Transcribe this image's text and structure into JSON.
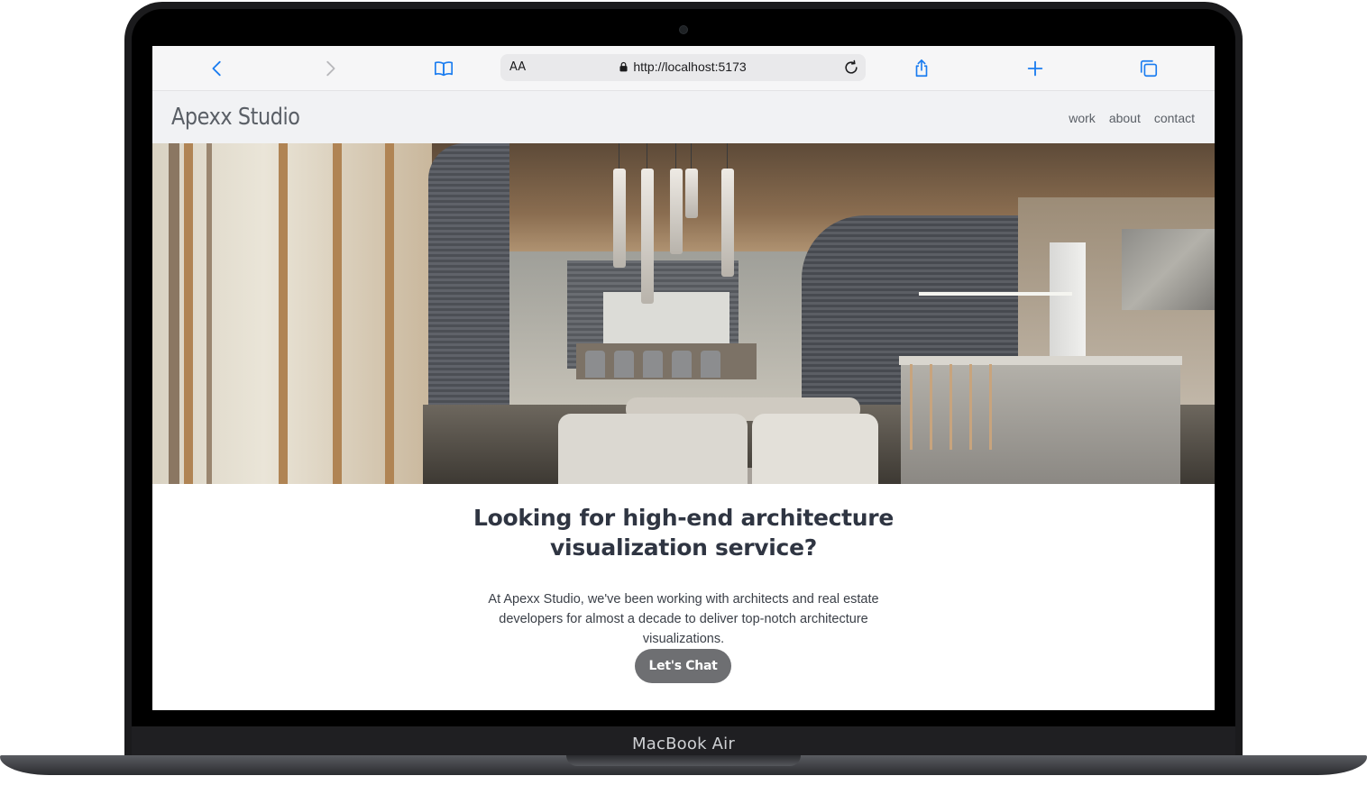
{
  "device": {
    "label": "MacBook Air"
  },
  "browser": {
    "text_size_label": "AA",
    "url": "http://localhost:5173",
    "icons": {
      "back": "chevron-left-icon",
      "forward": "chevron-right-icon",
      "bookmarks": "book-icon",
      "lock": "lock-icon",
      "reload": "reload-icon",
      "share": "share-icon",
      "new_tab": "plus-icon",
      "tabs": "tabs-icon"
    },
    "accent_color": "#1a7cf0"
  },
  "site": {
    "brand": "Apexx Studio",
    "nav": [
      {
        "label": "work"
      },
      {
        "label": "about"
      },
      {
        "label": "contact"
      }
    ],
    "hero": {
      "headline_line1": "Looking for high-end architecture",
      "headline_line2": "visualization service?",
      "paragraph": "At Apexx Studio, we've been working with architects and real estate developers for almost a decade to deliver top-notch architecture visualizations.",
      "cta_label": "Let's Chat"
    },
    "colors": {
      "headline": "#2f3542",
      "cta_background": "#6e6f72",
      "nav_background": "#f1f2f4"
    }
  }
}
